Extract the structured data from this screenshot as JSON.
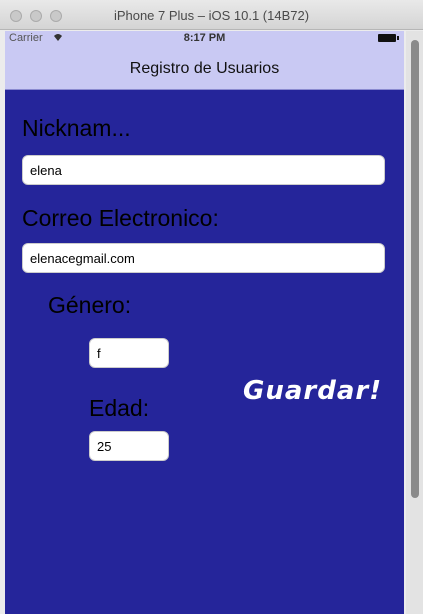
{
  "window": {
    "title": "iPhone 7 Plus – iOS 10.1 (14B72)"
  },
  "status_bar": {
    "carrier": "Carrier",
    "wifi": "wifi-icon",
    "time": "8:17 PM",
    "battery": "battery-icon"
  },
  "nav": {
    "title": "Registro de Usuarios"
  },
  "form": {
    "nickname_label": "Nicknam...",
    "nickname_value": "elena",
    "email_label": "Correo Electronico:",
    "email_value": "elenacegmail.com",
    "gender_label": "Género:",
    "gender_value": "f",
    "age_label": "Edad:",
    "age_value": "25",
    "save_label": "Guardar!"
  },
  "colors": {
    "screen_bg": "#25259a",
    "bar_bg": "#c9c9f3"
  }
}
